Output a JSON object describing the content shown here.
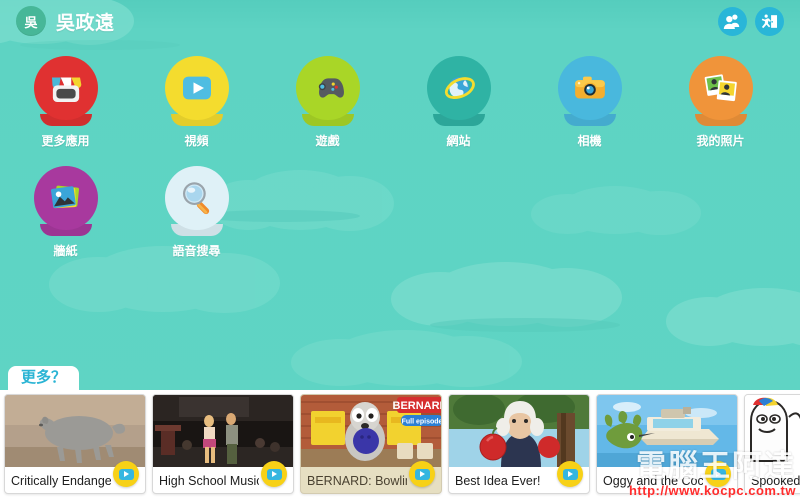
{
  "theme": {
    "background": "#5ed3c3",
    "cloud": "#77dccd",
    "accent_cyan": "#29b6d8",
    "tab_text": "#2ab4d4",
    "drawer_bg": "#ffffff",
    "play_badge": "#f7d117"
  },
  "header": {
    "avatar_initial": "吳",
    "username": "吳政遠",
    "actions": [
      {
        "name": "switch-user-button",
        "icon": "users-icon",
        "color": "#29b6d8"
      },
      {
        "name": "exit-button",
        "icon": "exit-door-icon",
        "color": "#29b6d8"
      }
    ]
  },
  "apps": [
    {
      "label": "更多應用",
      "icon": "store-icon",
      "color": "#e03131"
    },
    {
      "label": "視頻",
      "icon": "video-play-icon",
      "color": "#f4dc2e"
    },
    {
      "label": "遊戲",
      "icon": "gamepad-icon",
      "color": "#a9d627"
    },
    {
      "label": "網站",
      "icon": "globe-icon",
      "color": "#2fb3a4"
    },
    {
      "label": "相機",
      "icon": "camera-icon",
      "color": "#49b8dd"
    },
    {
      "label": "我的照片",
      "icon": "photos-icon",
      "color": "#f0943a"
    },
    {
      "label": "牆紙",
      "icon": "wallpaper-icon",
      "color": "#a8399e"
    },
    {
      "label": "語音搜尋",
      "icon": "magnifier-icon",
      "color": "#dff1f7"
    }
  ],
  "drawer": {
    "tab_label": "更多？",
    "cards": [
      {
        "title": "Critically Endangere...",
        "thumb": "rhino",
        "tinted": false,
        "play": true
      },
      {
        "title": "High School Musical ...",
        "thumb": "stage",
        "tinted": false,
        "play": true
      },
      {
        "title": "BERNARD: Bowling",
        "thumb": "bernard",
        "tinted": true,
        "play": true
      },
      {
        "title": "Best Idea Ever!",
        "thumb": "newton",
        "tinted": false,
        "play": true
      },
      {
        "title": "Oggy and the Cockro...",
        "thumb": "oggy",
        "tinted": false,
        "play": true
      },
      {
        "title": "Spooked!",
        "thumb": "spooked",
        "tinted": false,
        "play": false
      }
    ]
  },
  "thumb_overlays": {
    "bernard_title": "BERNARD",
    "bernard_sub": "Full episode"
  },
  "watermark": {
    "brand": "電腦王阿達",
    "url": "http://www.kocpc.com.tw"
  }
}
